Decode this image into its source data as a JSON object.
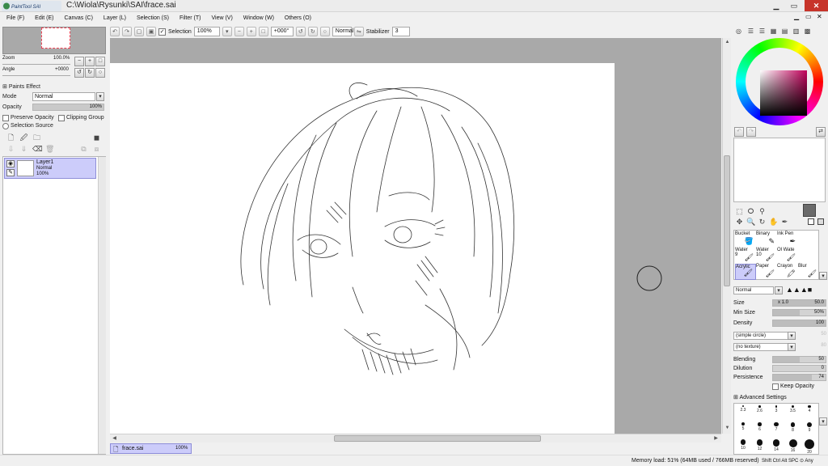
{
  "window": {
    "app_logo_text": "PaintTool SAI",
    "title": "C:\\Wiola\\Rysunki\\SAI\\frace.sai",
    "min": "▁",
    "max": "▭",
    "close": "✕"
  },
  "menu": [
    "File (F)",
    "Edit (E)",
    "Canvas (C)",
    "Layer (L)",
    "Selection (S)",
    "Filter (T)",
    "View (V)",
    "Window (W)",
    "Others (O)"
  ],
  "toolbar": {
    "selection_label": "Selection",
    "selection_checked": true,
    "zoom": "100%",
    "rotation": "+000°",
    "mode": "Normal",
    "stabilizer_label": "Stabilizer",
    "stabilizer_value": "3"
  },
  "navigator": {
    "zoom_label": "Zoom",
    "zoom_value": "100.0%",
    "angle_label": "Angle",
    "angle_value": "+0000"
  },
  "layer_props": {
    "paints_effect": "Paints Effect",
    "mode_label": "Mode",
    "mode_value": "Normal",
    "opacity_label": "Opacity",
    "opacity_value": "100%",
    "preserve_opacity": "Preserve Opacity",
    "clipping_group": "Clipping Group",
    "selection_source": "Selection Source"
  },
  "layers": [
    {
      "name": "Layer1",
      "mode": "Normal",
      "opacity": "100%"
    }
  ],
  "document_tab": {
    "name": "frace.sai",
    "zoom": "100%"
  },
  "status": {
    "memory": "Memory load: 51% (64MB used / 766MB reserved)",
    "keys": "Shift Ctrl Alt SPC ⊙ Any"
  },
  "tools": [
    {
      "name": "Bucket"
    },
    {
      "name": "Binary"
    },
    {
      "name": "Ink Pen"
    },
    {
      "name": ""
    },
    {
      "name": "Water",
      "size": "9"
    },
    {
      "name": "Water",
      "size": "10"
    },
    {
      "name": "Ol Wate"
    },
    {
      "name": ""
    },
    {
      "name": "Acrylic",
      "selected": true
    },
    {
      "name": "Paper"
    },
    {
      "name": "Crayon"
    },
    {
      "name": "Blur"
    }
  ],
  "brush": {
    "mode": "Normal",
    "size_label": "Size",
    "size_multiplier": "x 1.0",
    "size_value": "50.0",
    "min_size_label": "Min Size",
    "min_size_value": "50%",
    "min_size_fill": 0.5,
    "density_label": "Density",
    "density_value": "100",
    "density_fill": 1.0,
    "shape": "(simple circle)",
    "shape_value": "50",
    "texture": "(no texture)",
    "texture_value": "80",
    "blending_label": "Blending",
    "blending_value": "50",
    "blending_fill": 0.5,
    "dilution_label": "Dilution",
    "dilution_value": "0",
    "dilution_fill": 0.0,
    "persistence_label": "Persistence",
    "persistence_value": "74",
    "persistence_fill": 0.74,
    "keep_opacity": "Keep Opacity",
    "advanced": "Advanced Settings"
  },
  "brush_sizes": [
    "2.3",
    "2.6",
    "3",
    "3.5",
    "4",
    "5",
    "6",
    "7",
    "8",
    "9",
    "10",
    "12",
    "14",
    "16",
    "20"
  ],
  "colors": {
    "accent": "#ccccfa",
    "current_color": "#6a6a6a"
  }
}
